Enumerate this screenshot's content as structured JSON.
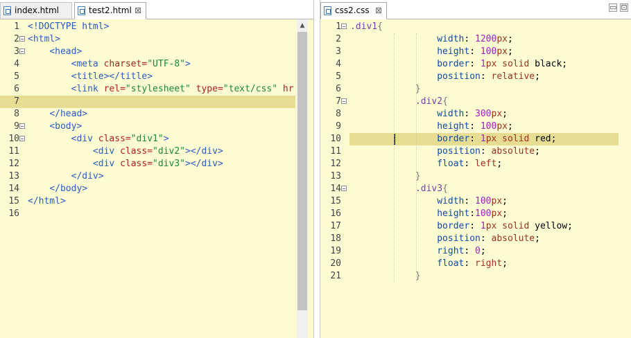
{
  "left_editor": {
    "tabs": [
      {
        "label": "index.html",
        "active": false
      },
      {
        "label": "test2.html",
        "active": true
      }
    ],
    "close_glyph": "⊠",
    "scroll_up_glyph": "▲",
    "lines": [
      {
        "n": "1",
        "fold": "",
        "tokens": [
          [
            "t-tag",
            "<!DOCTYPE html>"
          ]
        ]
      },
      {
        "n": "2",
        "fold": "⊟",
        "tokens": [
          [
            "t-tag",
            "<html>"
          ]
        ]
      },
      {
        "n": "3",
        "fold": "⊟",
        "tokens": [
          [
            "t-txt",
            "    "
          ],
          [
            "t-tag",
            "<head>"
          ]
        ]
      },
      {
        "n": "4",
        "fold": "",
        "tokens": [
          [
            "t-txt",
            "        "
          ],
          [
            "t-tag",
            "<meta "
          ],
          [
            "t-attr",
            "charset="
          ],
          [
            "t-str",
            "\"UTF-8\""
          ],
          [
            "t-tag",
            ">"
          ]
        ]
      },
      {
        "n": "5",
        "fold": "",
        "tokens": [
          [
            "t-txt",
            "        "
          ],
          [
            "t-tag",
            "<title></title>"
          ]
        ]
      },
      {
        "n": "6",
        "fold": "",
        "tokens": [
          [
            "t-txt",
            "        "
          ],
          [
            "t-tag",
            "<link "
          ],
          [
            "t-attr",
            "rel="
          ],
          [
            "t-str",
            "\"stylesheet\""
          ],
          [
            "t-txt",
            " "
          ],
          [
            "t-attr",
            "type="
          ],
          [
            "t-str",
            "\"text/css\""
          ],
          [
            "t-txt",
            " "
          ],
          [
            "t-attr",
            "hr"
          ]
        ]
      },
      {
        "n": "7",
        "fold": "",
        "highlight": true,
        "tokens": []
      },
      {
        "n": "8",
        "fold": "",
        "tokens": [
          [
            "t-txt",
            "    "
          ],
          [
            "t-tag",
            "</head>"
          ]
        ]
      },
      {
        "n": "9",
        "fold": "⊟",
        "tokens": [
          [
            "t-txt",
            "    "
          ],
          [
            "t-tag",
            "<body>"
          ]
        ]
      },
      {
        "n": "10",
        "fold": "⊟",
        "tokens": [
          [
            "t-txt",
            "        "
          ],
          [
            "t-tag",
            "<div "
          ],
          [
            "t-attr",
            "class="
          ],
          [
            "t-str",
            "\"div1\""
          ],
          [
            "t-tag",
            ">"
          ]
        ]
      },
      {
        "n": "11",
        "fold": "",
        "tokens": [
          [
            "t-txt",
            "            "
          ],
          [
            "t-tag",
            "<div "
          ],
          [
            "t-attr",
            "class="
          ],
          [
            "t-str",
            "\"div2\""
          ],
          [
            "t-tag",
            "></div>"
          ]
        ]
      },
      {
        "n": "12",
        "fold": "",
        "tokens": [
          [
            "t-txt",
            "            "
          ],
          [
            "t-tag",
            "<div "
          ],
          [
            "t-attr",
            "class="
          ],
          [
            "t-str",
            "\"div3\""
          ],
          [
            "t-tag",
            "></div>"
          ]
        ]
      },
      {
        "n": "13",
        "fold": "",
        "tokens": [
          [
            "t-txt",
            "        "
          ],
          [
            "t-tag",
            "</div>"
          ]
        ]
      },
      {
        "n": "14",
        "fold": "",
        "tokens": [
          [
            "t-txt",
            "    "
          ],
          [
            "t-tag",
            "</body>"
          ]
        ]
      },
      {
        "n": "15",
        "fold": "",
        "tokens": [
          [
            "t-tag",
            "</html>"
          ]
        ]
      },
      {
        "n": "16",
        "fold": "",
        "tokens": []
      }
    ]
  },
  "right_editor": {
    "tabs": [
      {
        "label": "css2.css",
        "active": true
      }
    ],
    "close_glyph": "⊠",
    "window_buttons": [
      "▭",
      "⊡"
    ],
    "lines": [
      {
        "n": "1",
        "fold": "⊟",
        "tokens": [
          [
            "t-sel",
            ".div1"
          ],
          [
            "t-pun",
            "{"
          ]
        ]
      },
      {
        "n": "2",
        "fold": "",
        "tokens": [
          [
            "t-txt",
            "                "
          ],
          [
            "t-prop",
            "width"
          ],
          [
            "t-txt",
            ": "
          ],
          [
            "t-num",
            "1200"
          ],
          [
            "t-kw",
            "px"
          ],
          [
            "t-txt",
            ";"
          ]
        ]
      },
      {
        "n": "3",
        "fold": "",
        "tokens": [
          [
            "t-txt",
            "                "
          ],
          [
            "t-prop",
            "height"
          ],
          [
            "t-txt",
            ": "
          ],
          [
            "t-num",
            "100"
          ],
          [
            "t-kw",
            "px"
          ],
          [
            "t-txt",
            ";"
          ]
        ]
      },
      {
        "n": "4",
        "fold": "",
        "tokens": [
          [
            "t-txt",
            "                "
          ],
          [
            "t-prop",
            "border"
          ],
          [
            "t-txt",
            ": "
          ],
          [
            "t-num",
            "1"
          ],
          [
            "t-kw",
            "px solid "
          ],
          [
            "t-txt",
            "black;"
          ]
        ]
      },
      {
        "n": "5",
        "fold": "",
        "tokens": [
          [
            "t-txt",
            "                "
          ],
          [
            "t-prop",
            "position"
          ],
          [
            "t-txt",
            ": "
          ],
          [
            "t-kw",
            "relative"
          ],
          [
            "t-txt",
            ";"
          ]
        ]
      },
      {
        "n": "6",
        "fold": "",
        "tokens": [
          [
            "t-txt",
            "            "
          ],
          [
            "t-pun",
            "}"
          ]
        ]
      },
      {
        "n": "7",
        "fold": "⊟",
        "tokens": [
          [
            "t-txt",
            "            "
          ],
          [
            "t-sel",
            ".div2"
          ],
          [
            "t-pun",
            "{"
          ]
        ]
      },
      {
        "n": "8",
        "fold": "",
        "tokens": [
          [
            "t-txt",
            "                "
          ],
          [
            "t-prop",
            "width"
          ],
          [
            "t-txt",
            ": "
          ],
          [
            "t-num",
            "300"
          ],
          [
            "t-kw",
            "px"
          ],
          [
            "t-txt",
            ";"
          ]
        ]
      },
      {
        "n": "9",
        "fold": "",
        "tokens": [
          [
            "t-txt",
            "                "
          ],
          [
            "t-prop",
            "height"
          ],
          [
            "t-txt",
            ": "
          ],
          [
            "t-num",
            "100"
          ],
          [
            "t-kw",
            "px"
          ],
          [
            "t-txt",
            ";"
          ]
        ]
      },
      {
        "n": "10",
        "fold": "",
        "highlight": true,
        "caret": true,
        "tokens": [
          [
            "t-txt",
            "                "
          ],
          [
            "t-prop",
            "border"
          ],
          [
            "t-txt",
            ": "
          ],
          [
            "t-num",
            "1"
          ],
          [
            "t-kw",
            "px solid "
          ],
          [
            "t-txt",
            "red;"
          ]
        ]
      },
      {
        "n": "11",
        "fold": "",
        "tokens": [
          [
            "t-txt",
            "                "
          ],
          [
            "t-prop",
            "position"
          ],
          [
            "t-txt",
            ": "
          ],
          [
            "t-kw",
            "absolute"
          ],
          [
            "t-txt",
            ";"
          ]
        ]
      },
      {
        "n": "12",
        "fold": "",
        "tokens": [
          [
            "t-txt",
            "                "
          ],
          [
            "t-prop",
            "float"
          ],
          [
            "t-txt",
            ": "
          ],
          [
            "t-kw",
            "left"
          ],
          [
            "t-txt",
            ";"
          ]
        ]
      },
      {
        "n": "13",
        "fold": "",
        "tokens": [
          [
            "t-txt",
            "            "
          ],
          [
            "t-pun",
            "}"
          ]
        ]
      },
      {
        "n": "14",
        "fold": "⊟",
        "tokens": [
          [
            "t-txt",
            "            "
          ],
          [
            "t-sel",
            ".div3"
          ],
          [
            "t-pun",
            "{"
          ]
        ]
      },
      {
        "n": "15",
        "fold": "",
        "tokens": [
          [
            "t-txt",
            "                "
          ],
          [
            "t-prop",
            "width"
          ],
          [
            "t-txt",
            ": "
          ],
          [
            "t-num",
            "100"
          ],
          [
            "t-kw",
            "px"
          ],
          [
            "t-txt",
            ";"
          ]
        ]
      },
      {
        "n": "16",
        "fold": "",
        "tokens": [
          [
            "t-txt",
            "                "
          ],
          [
            "t-prop",
            "height"
          ],
          [
            "t-txt",
            ":"
          ],
          [
            "t-num",
            "100"
          ],
          [
            "t-kw",
            "px"
          ],
          [
            "t-txt",
            ";"
          ]
        ]
      },
      {
        "n": "17",
        "fold": "",
        "tokens": [
          [
            "t-txt",
            "                "
          ],
          [
            "t-prop",
            "border"
          ],
          [
            "t-txt",
            ": "
          ],
          [
            "t-num",
            "1"
          ],
          [
            "t-kw",
            "px solid "
          ],
          [
            "t-txt",
            "yellow;"
          ]
        ]
      },
      {
        "n": "18",
        "fold": "",
        "tokens": [
          [
            "t-txt",
            "                "
          ],
          [
            "t-prop",
            "position"
          ],
          [
            "t-txt",
            ": "
          ],
          [
            "t-kw",
            "absolute"
          ],
          [
            "t-txt",
            ";"
          ]
        ]
      },
      {
        "n": "19",
        "fold": "",
        "tokens": [
          [
            "t-txt",
            "                "
          ],
          [
            "t-prop",
            "right"
          ],
          [
            "t-txt",
            ": "
          ],
          [
            "t-num",
            "0"
          ],
          [
            "t-txt",
            ";"
          ]
        ]
      },
      {
        "n": "20",
        "fold": "",
        "tokens": [
          [
            "t-txt",
            "                "
          ],
          [
            "t-prop",
            "float"
          ],
          [
            "t-txt",
            ": "
          ],
          [
            "t-kw",
            "right"
          ],
          [
            "t-txt",
            ";"
          ]
        ]
      },
      {
        "n": "21",
        "fold": "",
        "tokens": [
          [
            "t-txt",
            "            "
          ],
          [
            "t-pun",
            "}"
          ]
        ]
      }
    ]
  }
}
